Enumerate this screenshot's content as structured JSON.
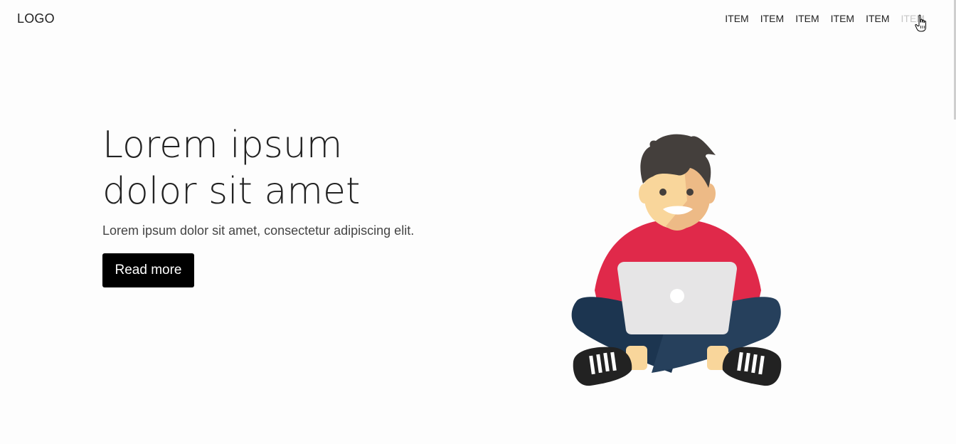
{
  "navbar": {
    "logo": "LOGO",
    "items": [
      {
        "label": "ITEM"
      },
      {
        "label": "ITEM"
      },
      {
        "label": "ITEM"
      },
      {
        "label": "ITEM"
      },
      {
        "label": "ITEM"
      },
      {
        "label": "ITEM"
      }
    ]
  },
  "hero": {
    "title": "Lorem ipsum dolor sit amet",
    "subtitle": "Lorem ipsum dolor sit amet, consectetur adipiscing elit.",
    "button_label": "Read more"
  },
  "colors": {
    "background": "#fdfdfd",
    "button": "#000000",
    "shirt": "#e0294a",
    "pants": "#1f3a56",
    "laptop": "#e6e5e6",
    "hair": "#443f3c",
    "skin": "#f9d69b"
  },
  "icons": {
    "cursor": "hand-pointer-icon",
    "illustration": "person-with-laptop-illustration"
  }
}
